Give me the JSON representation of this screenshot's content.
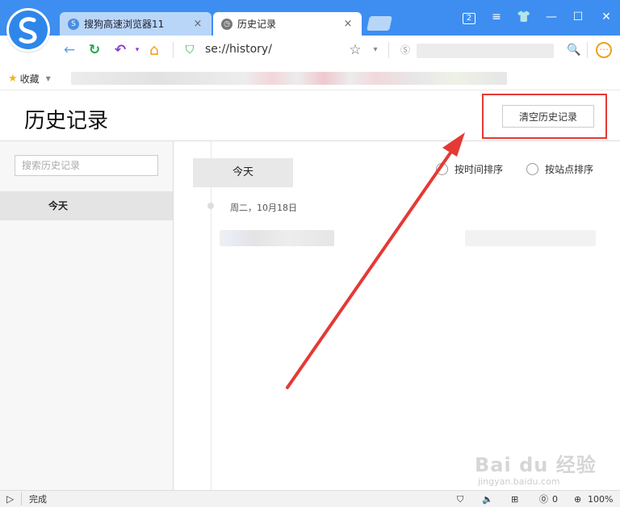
{
  "window": {
    "tabs": [
      {
        "label": "搜狗高速浏览器11",
        "close": "×"
      },
      {
        "label": "历史记录",
        "close": "×"
      }
    ],
    "controls": {
      "badge": "2",
      "menu": "≡",
      "skin": "👕",
      "minimize": "—",
      "maximize": "☐",
      "close": "✕"
    }
  },
  "toolbar": {
    "back": "←",
    "refresh": "↻",
    "undo": "↶",
    "home": "⌂",
    "url": "se://history/",
    "star": "☆",
    "caret": "▾",
    "search": "🔍",
    "more": "⋯"
  },
  "bookmarks": {
    "label": "收藏"
  },
  "page": {
    "title": "历史记录",
    "clear_button": "清空历史记录"
  },
  "sidebar": {
    "search_placeholder": "搜索历史记录",
    "items": [
      {
        "label": "今天"
      }
    ]
  },
  "main": {
    "today_label": "今天",
    "sort_by_time": "按时间排序",
    "sort_by_site": "按站点排序",
    "day_header": "周二，10月18日"
  },
  "statusbar": {
    "status": "完成",
    "count": "0",
    "zoom": "100%"
  },
  "watermark": {
    "text": "Bai du 经验",
    "sub": "jingyan.baidu.com"
  }
}
